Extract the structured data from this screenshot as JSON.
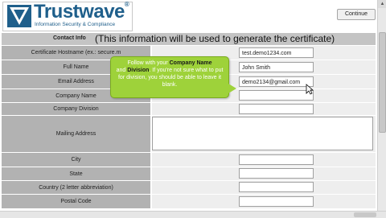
{
  "brand": {
    "name": "Trustwave",
    "trademark": "®",
    "tagline": "Information Security & Compliance"
  },
  "header": {
    "continue_label": "Continue"
  },
  "section": {
    "title_small": "Contact Info",
    "title_large": "(This information will be used to generate the certificate)"
  },
  "fields": {
    "hostname": {
      "label": "Certificate Hostname (ex.: secure.m",
      "value": "test.demo1234.com"
    },
    "full_name": {
      "label": "Full Name",
      "value": "John Smith"
    },
    "email": {
      "label": "Email Address",
      "value": "demo2134@gmail.com"
    },
    "company_name": {
      "label": "Company Name",
      "value": ""
    },
    "company_division": {
      "label": "Company Division",
      "value": ""
    },
    "mailing_address": {
      "label": "Mailing Address",
      "value": ""
    },
    "city": {
      "label": "City",
      "value": ""
    },
    "state": {
      "label": "State",
      "value": ""
    },
    "country": {
      "label": "Country (2 letter abbreviation)",
      "value": ""
    },
    "postal_code": {
      "label": "Postal Code",
      "value": ""
    }
  },
  "tooltip": {
    "line1_pre": "Follow with your ",
    "company_name": "Company Name",
    "line2_pre": "and ",
    "division": "Division",
    "rest": ". If you're not sure what to put for division, you should be able to leave it blank."
  },
  "colors": {
    "brand": "#1f5f8b",
    "label_bg": "#b2b2b2",
    "title_bg": "#c4c4c4",
    "tooltip_bg": "#9ed23a"
  },
  "icons": {
    "logo": "trustwave-logo-icon",
    "cursor": "mouse-cursor-icon"
  }
}
